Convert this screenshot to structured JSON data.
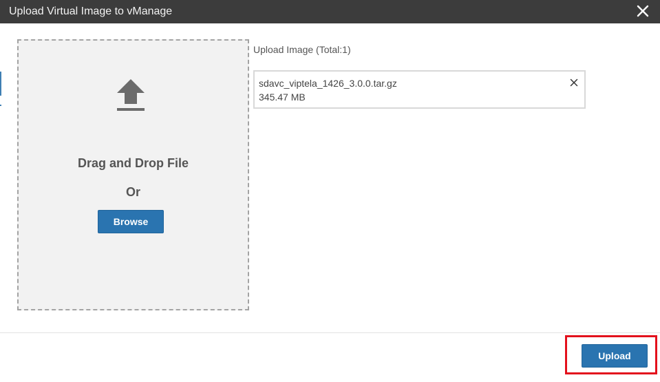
{
  "dialog": {
    "title": "Upload Virtual Image to vManage",
    "close_icon": "close-icon"
  },
  "dropzone": {
    "icon": "upload-arrow-icon",
    "drag_text": "Drag and Drop File",
    "or_text": "Or",
    "browse_label": "Browse"
  },
  "upload_list": {
    "label": "Upload Image (Total:1)",
    "files": [
      {
        "name": "sdavc_viptela_1426_3.0.0.tar.gz",
        "size": "345.47 MB",
        "remove_icon": "close-icon"
      }
    ]
  },
  "footer": {
    "upload_label": "Upload"
  },
  "colors": {
    "title_bar": "#3c3c3c",
    "primary_button": "#2a74b0",
    "highlight": "#e3101c",
    "dropzone_bg": "#f2f2f2"
  }
}
